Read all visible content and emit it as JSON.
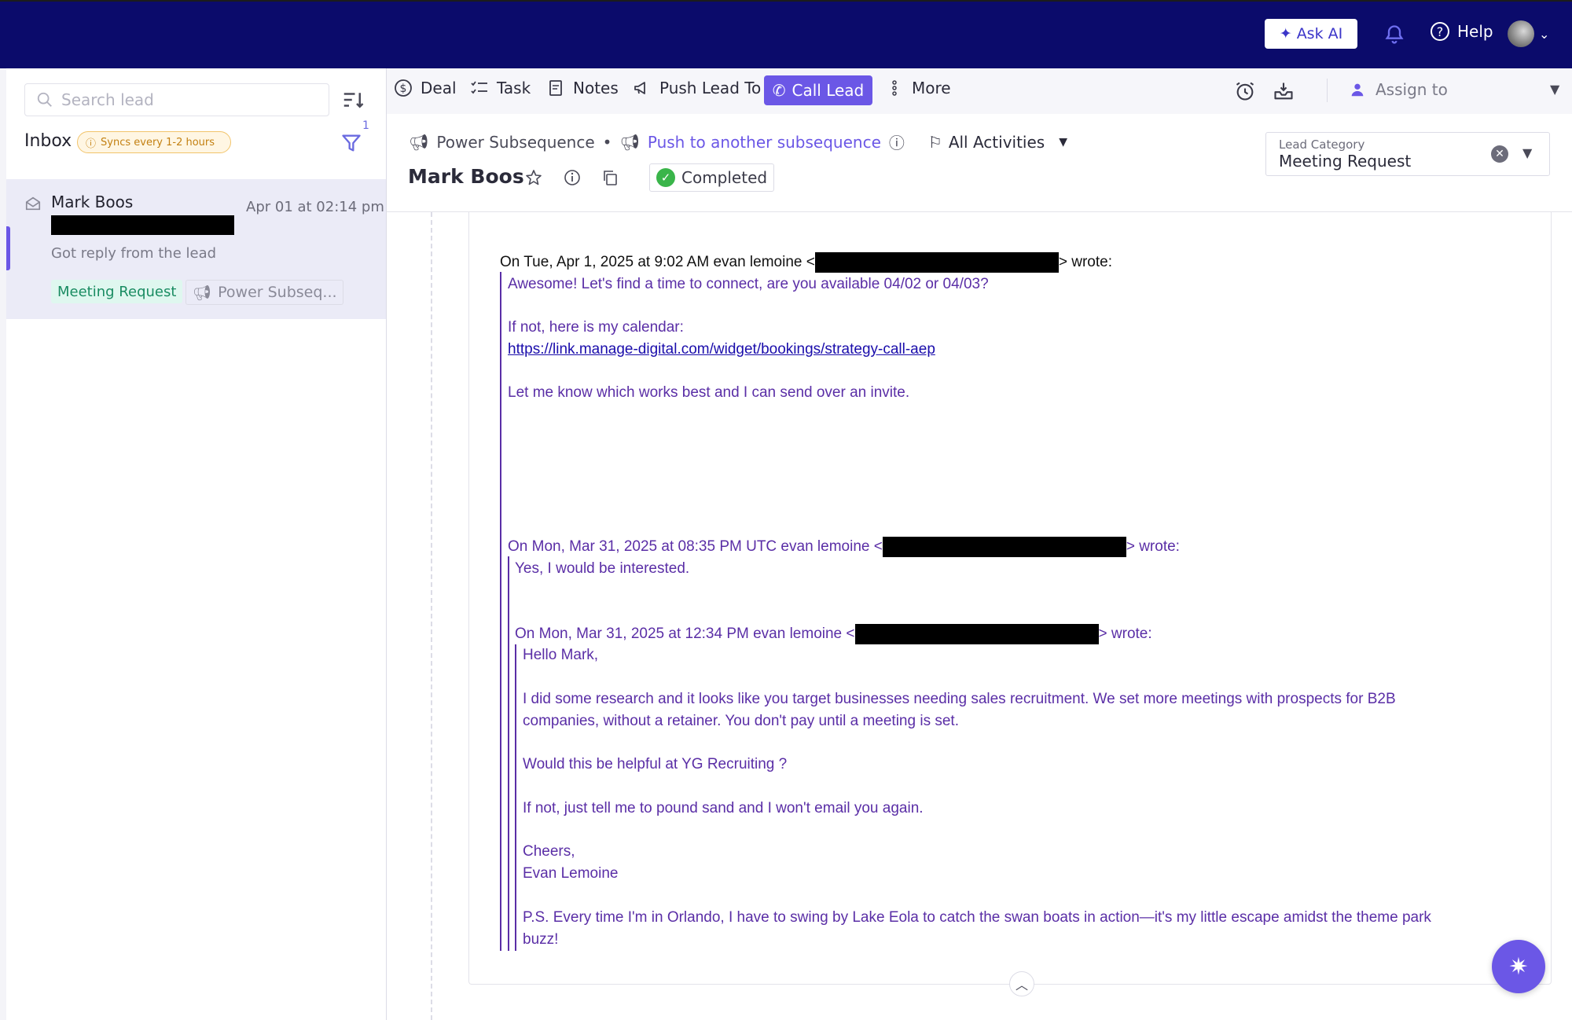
{
  "topbar": {
    "ask_ai_label": "Ask AI",
    "help_label": "Help"
  },
  "sidebar": {
    "search_placeholder": "Search lead",
    "inbox_title": "Inbox",
    "sync_badge": "Syncs every 1-2 hours",
    "filter_count": "1",
    "lead": {
      "name": "Mark Boos",
      "date": "Apr 01 at 02:14 pm",
      "snippet": "Got reply from the lead",
      "category_tag": "Meeting Request",
      "subsequence_tag": "Power Subseq..."
    }
  },
  "toolbar": {
    "deal": "Deal",
    "task": "Task",
    "notes": "Notes",
    "push_lead": "Push Lead To",
    "call_lead": "Call Lead",
    "more": "More",
    "assign": "Assign to"
  },
  "lead_header": {
    "subsequence": "Power Subsequence",
    "push_link": "Push to another subsequence",
    "activities": "All Activities",
    "name": "Mark Boos",
    "status": "Completed",
    "category_label": "Lead Category",
    "category_value": "Meeting Request"
  },
  "email": {
    "q1_header_pre": "On Tue, Apr 1, 2025 at 9:02 AM evan lemoine <",
    "q1_header_post": "> wrote:",
    "q1_line1": "Awesome! Let's find a time to connect, are you available 04/02 or 04/03?",
    "q1_line2": "If not, here is my calendar:",
    "q1_link": "https://link.manage-digital.com/widget/bookings/strategy-call-aep",
    "q1_line3": "Let me know which works best and I can send over an invite.",
    "q2_header_pre": "On Mon, Mar 31, 2025 at 08:35 PM UTC evan lemoine <",
    "q2_header_post": "> wrote:",
    "q2_line1": "Yes, I would be interested.",
    "q3_header_pre": "On Mon, Mar 31, 2025 at 12:34 PM evan lemoine <",
    "q3_header_post": "> wrote:",
    "q3_greeting": "Hello Mark,",
    "q3_p1a": "I did some research and it looks like you target businesses needing sales recruitment. We set more meetings with prospects for B2B",
    "q3_p1b": "companies, without a retainer. You don't pay until a meeting is set.",
    "q3_p2": "Would this be helpful at YG Recruiting ?",
    "q3_p3": "If not, just tell me to pound sand and I won't email you again.",
    "q3_sign1": "Cheers,",
    "q3_sign2": "Evan Lemoine",
    "q3_ps1": "P.S. Every time I'm in Orlando, I have to swing by Lake Eola to catch the swan boats in action—it's my little escape amidst the theme park",
    "q3_ps2": "buzz!"
  },
  "colors": {
    "topbar": "#0b0b6b",
    "accent": "#6b57e6",
    "quote_text": "#5a2ea6",
    "completed_green": "#3ab54a"
  },
  "icons": {
    "topbar": [
      "sparkle-icon",
      "bell-icon",
      "help-icon",
      "chevron-down-icon"
    ],
    "toolbar": [
      "dollar-icon",
      "task-list-icon",
      "notes-icon",
      "megaphone-icon",
      "phone-icon",
      "more-vertical-icon",
      "alarm-icon",
      "inbox-tray-icon",
      "user-icon"
    ],
    "other": [
      "search-icon",
      "sort-icon",
      "filter-icon",
      "mail-open-icon",
      "star-icon",
      "info-icon",
      "copy-icon",
      "check-icon",
      "flag-icon",
      "clear-icon"
    ]
  }
}
